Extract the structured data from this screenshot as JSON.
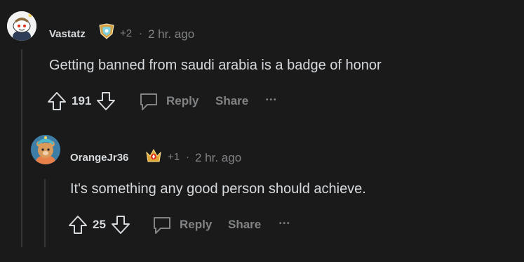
{
  "comments": [
    {
      "username": "Vastatz",
      "award_icon": "shield-award-icon",
      "karma": "+2",
      "separator": "·",
      "timestamp": "2 hr. ago",
      "body": "Getting banned from saudi arabia is a badge of honor",
      "vote_count": "191",
      "reply_label": "Reply",
      "share_label": "Share",
      "more_label": "•••"
    },
    {
      "username": "OrangeJr36",
      "award_icon": "crown-award-icon",
      "karma": "+1",
      "separator": "·",
      "timestamp": "2 hr. ago",
      "body": "It's something any good person should achieve.",
      "vote_count": "25",
      "reply_label": "Reply",
      "share_label": "Share",
      "more_label": "•••"
    }
  ],
  "colors": {
    "background": "#1a1a1b",
    "text": "#d7dadc",
    "muted": "#818384",
    "thread_line": "#343536"
  }
}
